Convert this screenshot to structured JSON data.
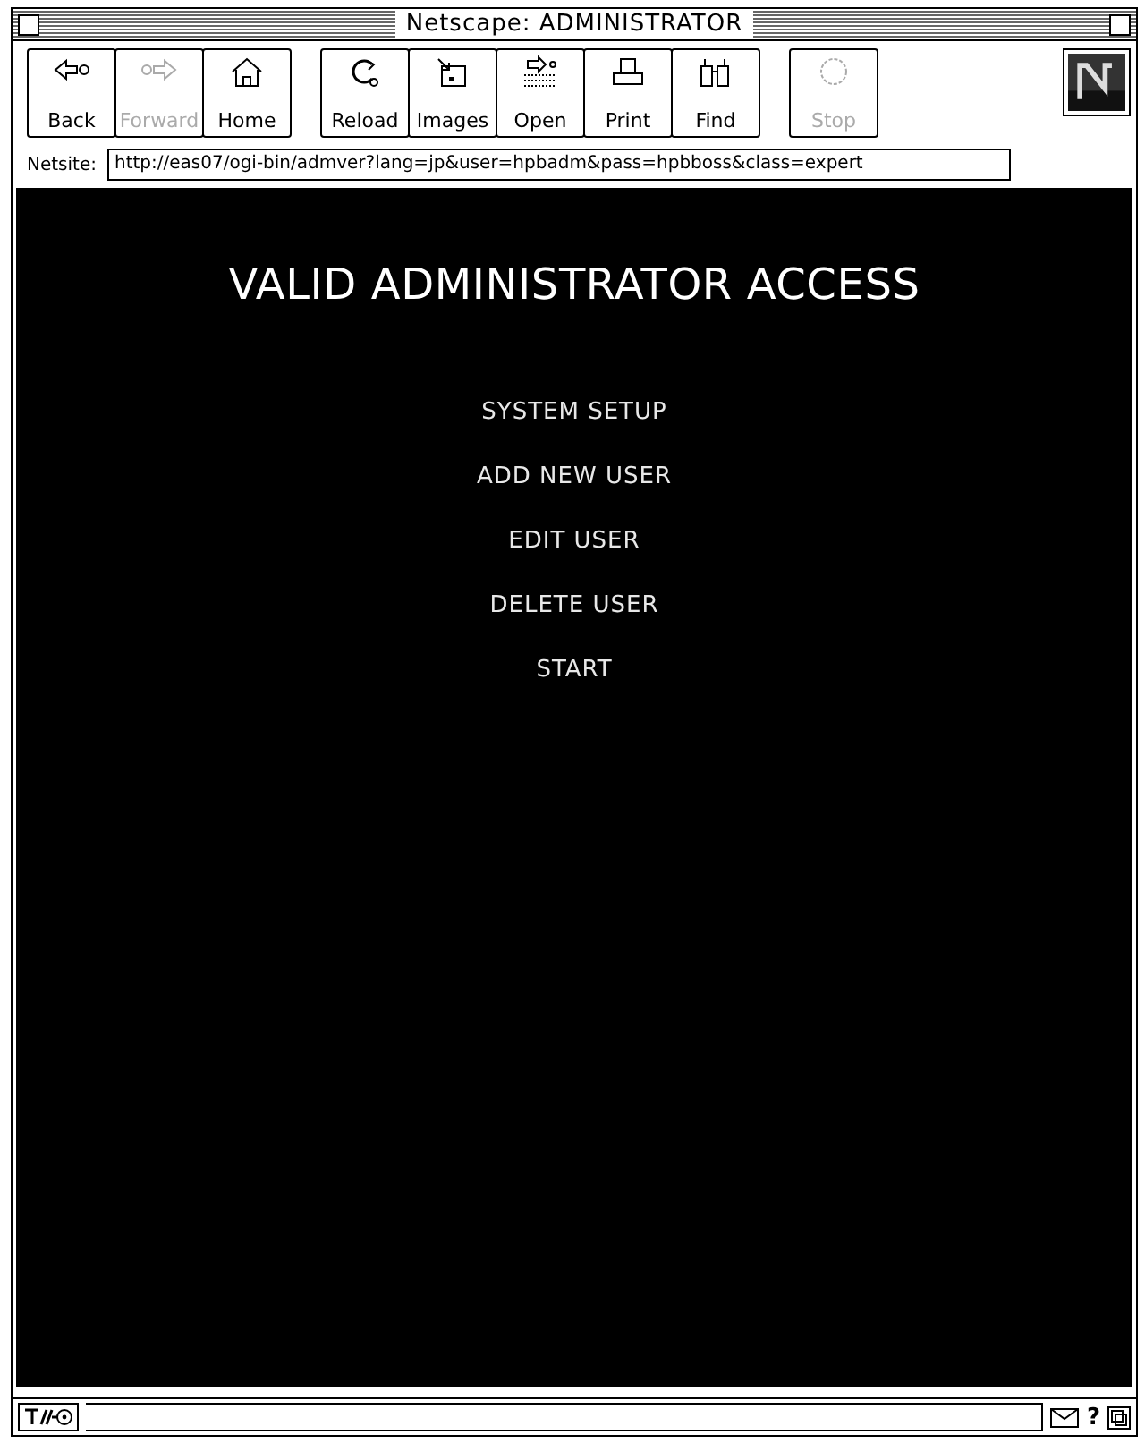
{
  "window": {
    "title": "Netscape: ADMINISTRATOR"
  },
  "toolbar": {
    "groups": [
      [
        {
          "label": "Back",
          "kind": "back",
          "disabled": false
        },
        {
          "label": "Forward",
          "kind": "forward",
          "disabled": true
        },
        {
          "label": "Home",
          "kind": "home",
          "disabled": false
        }
      ],
      [
        {
          "label": "Reload",
          "kind": "reload",
          "disabled": false
        },
        {
          "label": "Images",
          "kind": "images",
          "disabled": false
        },
        {
          "label": "Open",
          "kind": "open",
          "disabled": false
        },
        {
          "label": "Print",
          "kind": "print",
          "disabled": false
        },
        {
          "label": "Find",
          "kind": "find",
          "disabled": false
        }
      ],
      [
        {
          "label": "Stop",
          "kind": "stop",
          "disabled": true
        }
      ]
    ]
  },
  "location": {
    "label": "Netsite:",
    "value": "http://eas07/ogi-bin/admver?lang=jp&user=hpbadm&pass=hpbboss&class=expert"
  },
  "page": {
    "heading": "VALID ADMINISTRATOR ACCESS",
    "menu": [
      "SYSTEM SETUP",
      "ADD NEW USER",
      "EDIT USER",
      "DELETE USER",
      "START"
    ]
  },
  "status_bar": {
    "help": "?"
  }
}
